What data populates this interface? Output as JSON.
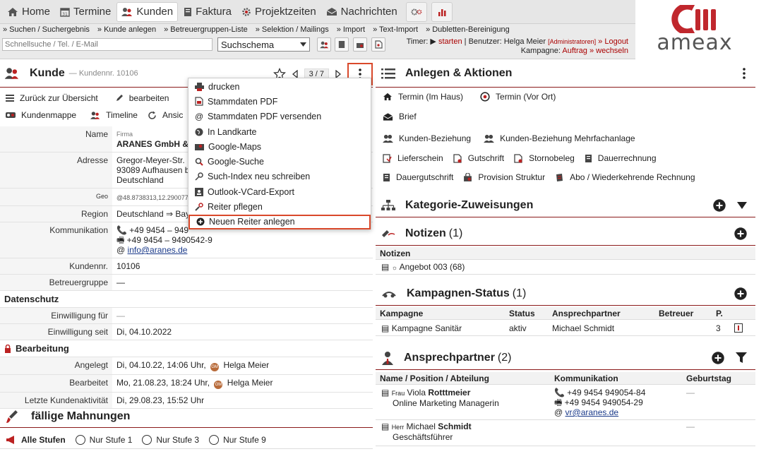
{
  "topnav": {
    "items": [
      {
        "label": "Home",
        "icon": "home-icon"
      },
      {
        "label": "Termine",
        "icon": "calendar-icon"
      },
      {
        "label": "Kunden",
        "icon": "customers-icon",
        "active": true
      },
      {
        "label": "Faktura",
        "icon": "invoice-icon"
      },
      {
        "label": "Projektzeiten",
        "icon": "gear-icon"
      },
      {
        "label": "Nachrichten",
        "icon": "mail-icon"
      }
    ]
  },
  "subnav": [
    "» Suchen / Suchergebnis",
    "» Kunde anlegen",
    "» Betreuergruppen-Liste",
    "» Selektion / Mailings",
    "» Import",
    "» Text-Import",
    "» Dubletten-Bereinigung"
  ],
  "toolbar": {
    "quick_search_placeholder": "Schnellsuche / Tel. / E-Mail",
    "schema_value": "Suchschema",
    "timer_label": "Timer:",
    "timer_start": "starten",
    "user_label": "| Benutzer: Helga Meier",
    "user_role": "[Administratoren]",
    "logout": "» Logout",
    "campaign_label": "Kampagne:",
    "campaign_value": "Auftrag",
    "campaign_switch": "» wechseln"
  },
  "logo": {
    "text": "ameax",
    "accent": "#c0272d"
  },
  "customer": {
    "title": "Kunde",
    "subtitle": "— Kundennr. 10106",
    "pager": "3 / 7",
    "actions1": [
      "Zurück zur Übersicht",
      "bearbeiten"
    ],
    "actions2": [
      "Kundenmappe",
      "Timeline",
      "Ansic"
    ],
    "fields": {
      "name_label": "Name",
      "firm_label": "Firma",
      "name_value": "ARANES GmbH &",
      "address_label": "Adresse",
      "address_line1": "Gregor-Meyer-Str.",
      "address_line2": "93089 Aufhausen b",
      "address_line3": "Deutschland",
      "geo_label": "Geo",
      "geo_value": "@48.8738313,12.290077",
      "region_label": "Region",
      "region_value": "Deutschland ⇒ Bay",
      "comm_label": "Kommunikation",
      "phone": "+49 9454 – 949",
      "fax": "+49 9454 – 9490542-9",
      "email": "info@aranes.de",
      "custno_label": "Kundennr.",
      "custno_value": "10106",
      "group_label": "Betreuergruppe",
      "group_value": "—",
      "privacy_section": "Datenschutz",
      "consent_for_label": "Einwilligung für",
      "consent_for_value": "—",
      "consent_since_label": "Einwilligung seit",
      "consent_since_value": "Di, 04.10.2022",
      "edit_section": "Bearbeitung",
      "created_label": "Angelegt",
      "created_value": "Di, 04.10.22, 14:06 Uhr,",
      "created_user": "Helga Meier",
      "edited_label": "Bearbeitet",
      "edited_value": "Mo, 21.08.23, 18:24 Uhr,",
      "edited_user": "Helga Meier",
      "last_activity_label": "Letzte Kundenaktivität",
      "last_activity_value": "Di, 29.08.23, 15:52 Uhr",
      "user_badge": "GM"
    },
    "dunning": {
      "title": "fällige Mahnungen",
      "filters": [
        "Alle Stufen",
        "Nur Stufe 1",
        "Nur Stufe 3",
        "Nur Stufe 9"
      ]
    }
  },
  "dropdown": {
    "items": [
      {
        "label": "drucken",
        "icon": "printer-icon"
      },
      {
        "label": "Stammdaten PDF",
        "icon": "pdf-icon"
      },
      {
        "label": "Stammdaten PDF versenden",
        "icon": "at-icon"
      },
      {
        "label": "In Landkarte",
        "icon": "globe-icon"
      },
      {
        "label": "Google-Maps",
        "icon": "map-icon"
      },
      {
        "label": "Google-Suche",
        "icon": "search-icon"
      },
      {
        "label": "Such-Index neu schreiben",
        "icon": "key-icon"
      },
      {
        "label": "Outlook-VCard-Export",
        "icon": "contact-card-icon"
      },
      {
        "label": "Reiter pflegen",
        "icon": "wrench-icon"
      },
      {
        "label": "Neuen Reiter anlegen",
        "icon": "plus-circle-icon",
        "highlighted": true
      }
    ]
  },
  "right": {
    "create_title": "Anlegen & Aktionen",
    "actions_row1": [
      "Termin (Im Haus)",
      "Termin (Vor Ort)"
    ],
    "actions_row2": [
      "Brief"
    ],
    "actions_row3": [
      "Kunden-Beziehung",
      "Kunden-Beziehung Mehrfachanlage"
    ],
    "actions_row4": [
      "Lieferschein",
      "Gutschrift",
      "Stornobeleg",
      "Dauerrechnung"
    ],
    "actions_row5": [
      "Dauergutschrift",
      "Provision Struktur",
      "Abo / Wiederkehrende Rechnung"
    ],
    "category_title": "Kategorie-Zuweisungen",
    "notes_title": "Notizen",
    "notes_count": "(1)",
    "notes_header": "Notizen",
    "notes_item": "Angebot 003 (68)",
    "campaign_title": "Kampagnen-Status",
    "campaign_count": "(1)",
    "campaign_headers": [
      "Kampagne",
      "Status",
      "Ansprechpartner",
      "Betreuer",
      "P."
    ],
    "campaign_row": {
      "name": "Kampagne Sanitär",
      "status": "aktiv",
      "contact": "Michael Schmidt",
      "owner": "",
      "p": "3"
    },
    "contacts_title": "Ansprechpartner",
    "contacts_count": "(2)",
    "contacts_headers": [
      "Name / Position / Abteilung",
      "Kommunikation",
      "Geburtstag"
    ],
    "contact1": {
      "salutation": "Frau",
      "first": "Viola",
      "last": "Rotttmeier",
      "position": "Online Marketing Managerin",
      "phone": "+49 9454 949054-84",
      "fax": "+49 9454 949054-29",
      "email": "vr@aranes.de",
      "birthday": "—"
    },
    "contact2": {
      "salutation": "Herr",
      "first": "Michael",
      "last": "Schmidt",
      "position": "Geschäftsführer",
      "birthday": "—"
    }
  },
  "colors": {
    "section_rule": "#8b1a1a",
    "highlight": "#d9492b",
    "link": "#1a3a8a"
  }
}
